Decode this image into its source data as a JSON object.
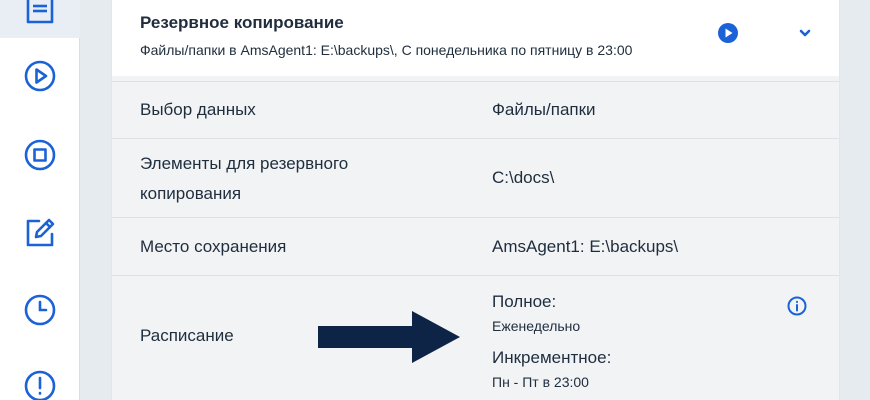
{
  "colors": {
    "accent": "#1a62d6",
    "arrow": "#0e2446"
  },
  "rail": {
    "items": [
      {
        "icon": "backup-plan-icon",
        "active": true
      },
      {
        "icon": "run-icon"
      },
      {
        "icon": "stop-icon"
      },
      {
        "icon": "edit-icon"
      },
      {
        "icon": "clock-icon"
      },
      {
        "icon": "alert-icon"
      }
    ]
  },
  "plan": {
    "title": "Резервное копирование",
    "subtitle": "Файлы/папки в AmsAgent1: E:\\backups\\, С понедельника по пятницу в 23:00",
    "run_icon": "play-circle-icon",
    "expand_icon": "chevron-down-icon"
  },
  "details": {
    "data_selection": {
      "label": "Выбор данных",
      "value": "Файлы/папки"
    },
    "items": {
      "label_line1": "Элементы для резервного",
      "label_line2": "копирования",
      "value": "C:\\docs\\"
    },
    "destination": {
      "label": "Место сохранения",
      "value": "AmsAgent1: E:\\backups\\"
    },
    "schedule": {
      "label": "Расписание",
      "full_label": "Полное:",
      "full_value": "Еженедельно",
      "incremental_label": "Инкрементное:",
      "incremental_value": "Пн - Пт в 23:00",
      "info_icon": "info-icon"
    }
  },
  "annotation": {
    "icon": "arrow-right-icon"
  }
}
